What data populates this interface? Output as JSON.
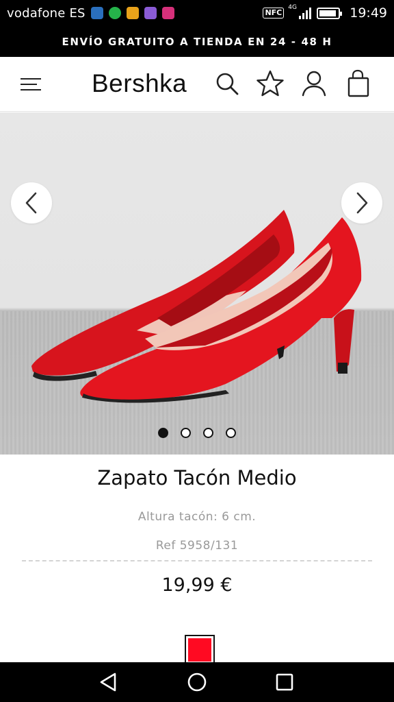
{
  "status_bar": {
    "carrier": "vodafone ES",
    "nfc": "NFC",
    "network": "4G",
    "time": "19:49",
    "battery_level": 0.9
  },
  "promo_banner": "ENVÍO GRATUITO A TIENDA EN 24 - 48 H",
  "header": {
    "logo": "Bershka"
  },
  "carousel": {
    "total_images": 4,
    "active_index": 0
  },
  "product": {
    "name": "Zapato Tacón Medio",
    "description": "Altura tacón: 6 cm.",
    "reference": "Ref 5958/131",
    "price": "19,99 €",
    "color_swatch": "#ff0a22"
  },
  "icons": {
    "menu": "hamburger-menu-icon",
    "search": "search-icon",
    "wishlist": "star-icon",
    "account": "user-icon",
    "bag": "shopping-bag-icon",
    "prev": "chevron-left-icon",
    "next": "chevron-right-icon",
    "back": "back-triangle-icon",
    "home": "home-circle-icon",
    "recents": "recents-square-icon"
  }
}
